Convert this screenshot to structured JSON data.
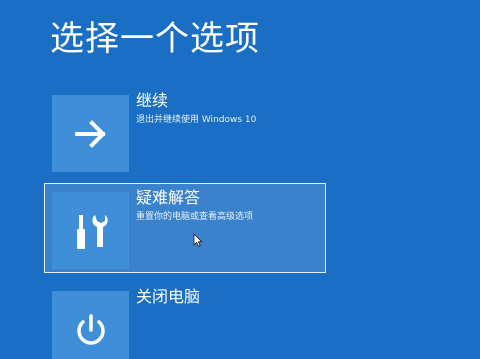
{
  "title": "选择一个选项",
  "options": [
    {
      "label": "继续",
      "description": "退出并继续使用 Windows 10",
      "icon": "arrow-right-icon",
      "selected": false
    },
    {
      "label": "疑难解答",
      "description": "重置你的电脑或查看高级选项",
      "icon": "tools-icon",
      "selected": true
    },
    {
      "label": "关闭电脑",
      "description": "",
      "icon": "power-icon",
      "selected": false
    }
  ],
  "colors": {
    "background": "#1a6fc4",
    "tile": "#3f8fd8",
    "text": "#ffffff",
    "selection_border": "#e8eef6"
  }
}
